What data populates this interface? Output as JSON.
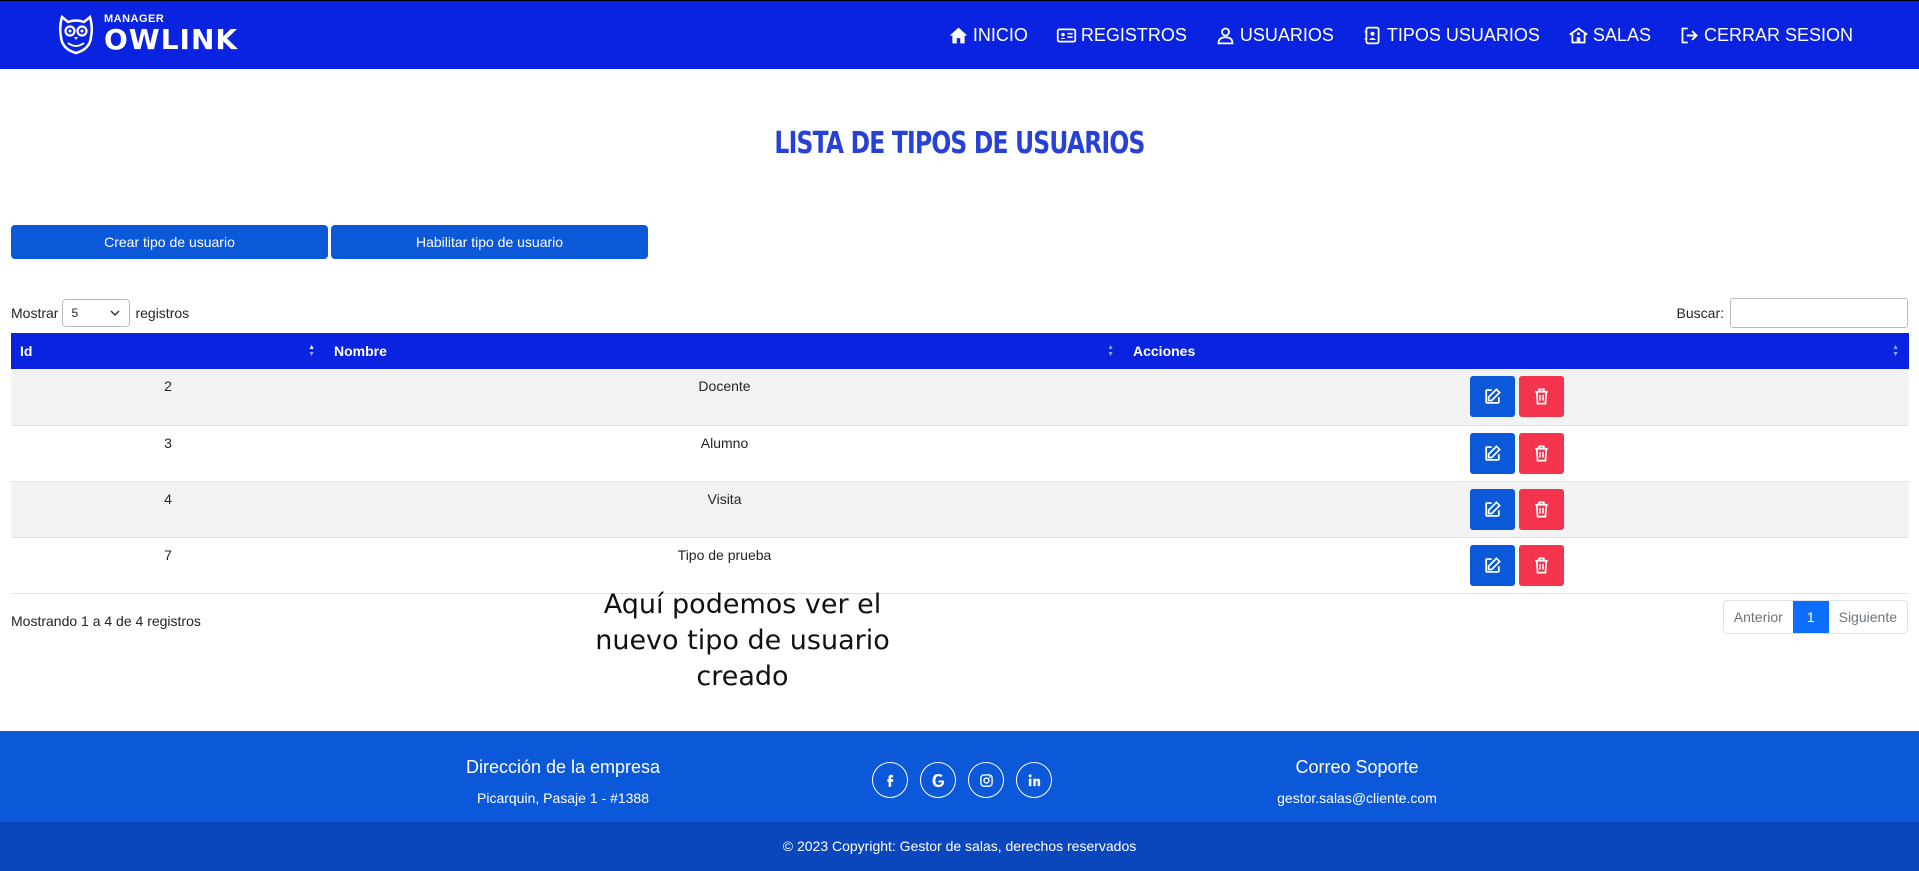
{
  "brand": {
    "small": "MANAGER",
    "big": "OWLINK"
  },
  "nav": [
    {
      "label": "INICIO",
      "icon": "home-icon"
    },
    {
      "label": "REGISTROS",
      "icon": "id-card-icon"
    },
    {
      "label": "USUARIOS",
      "icon": "user-icon"
    },
    {
      "label": "TIPOS USUARIOS",
      "icon": "contact-book-icon"
    },
    {
      "label": "SALAS",
      "icon": "school-icon"
    },
    {
      "label": "CERRAR SESION",
      "icon": "logout-icon"
    }
  ],
  "page": {
    "title": "LISTA DE TIPOS DE USUARIOS"
  },
  "actions": {
    "create": "Crear tipo de usuario",
    "enable": "Habilitar tipo de usuario"
  },
  "length": {
    "prefix": "Mostrar",
    "value": "5",
    "suffix": "registros"
  },
  "search": {
    "label": "Buscar:",
    "value": ""
  },
  "table": {
    "headers": [
      "Id",
      "Nombre",
      "Acciones"
    ],
    "rows": [
      {
        "id": "2",
        "name": "Docente"
      },
      {
        "id": "3",
        "name": "Alumno"
      },
      {
        "id": "4",
        "name": "Visita"
      },
      {
        "id": "7",
        "name": "Tipo de prueba"
      }
    ]
  },
  "info": "Mostrando 1 a 4 de 4 registros",
  "annotation": "Aquí podemos ver el nuevo tipo de usuario creado",
  "pagination": {
    "prev": "Anterior",
    "current": "1",
    "next": "Siguiente"
  },
  "footer": {
    "address_title": "Dirección de la empresa",
    "address": "Picarquin, Pasaje 1 - #1388",
    "mail_title": "Correo Soporte",
    "mail": "gestor.salas@cliente.com",
    "socials": [
      "facebook-icon",
      "google-icon",
      "instagram-icon",
      "linkedin-icon"
    ],
    "copyright": "© 2023 Copyright: Gestor de salas, derechos reservados"
  },
  "colors": {
    "nav": "#0a23e0",
    "primary": "#0b58d8",
    "danger": "#f3344c",
    "title": "#2740d8"
  }
}
